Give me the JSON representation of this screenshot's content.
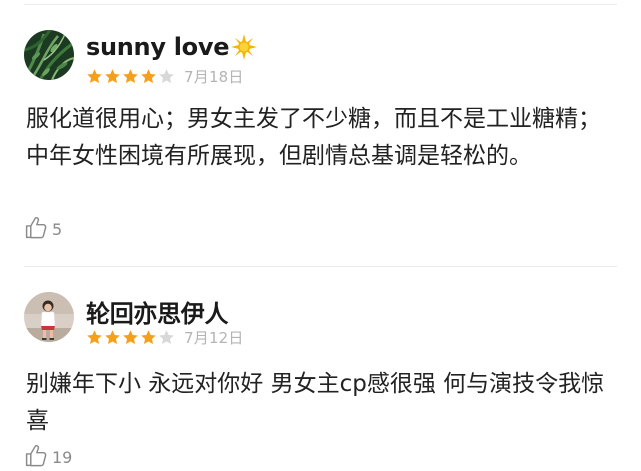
{
  "colors": {
    "star_filled": "#f6a01a",
    "star_empty": "#d8d8d8",
    "date_text": "#b4b4b4",
    "like_count_text": "#8a8a8a",
    "divider": "#ececec"
  },
  "reviews": [
    {
      "user_name": "sunny love",
      "name_emoji_icon": "sun-icon",
      "rating": 4,
      "rating_max": 5,
      "date": "7月18日",
      "text": "服化道很用心；男女主发了不少糖，而且不是工业糖精；中年女性困境有所展现，但剧情总基调是轻松的。",
      "like_icon": "thumbs-up-icon",
      "likes": "5"
    },
    {
      "user_name": "轮回亦思伊人",
      "rating": 4,
      "rating_max": 5,
      "date": "7月12日",
      "text": "别嫌年下小 永远对你好 男女主cp感很强 何与演技令我惊喜",
      "like_icon": "thumbs-up-icon",
      "likes": "19"
    }
  ]
}
